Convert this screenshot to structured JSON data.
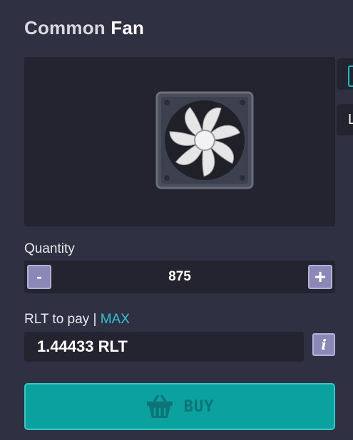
{
  "item": {
    "rarity": "Common",
    "name": "Fan",
    "image_icon": "fan-icon"
  },
  "quantity": {
    "label": "Quantity",
    "value": "875",
    "minus_label": "-",
    "plus_label": "+"
  },
  "payment": {
    "label": "RLT to pay",
    "separator": "|",
    "max_label": "MAX",
    "value": "1.44433 RLT",
    "info_label": "i"
  },
  "buy": {
    "label": "BUY",
    "icon": "basket-icon"
  },
  "side_tabs": {
    "tab2_label": "L"
  },
  "colors": {
    "background": "#2f3142",
    "panel": "#23242f",
    "accent": "#0aa19f",
    "max_link": "#2fc3d2",
    "stepper": "#8b88b8"
  }
}
